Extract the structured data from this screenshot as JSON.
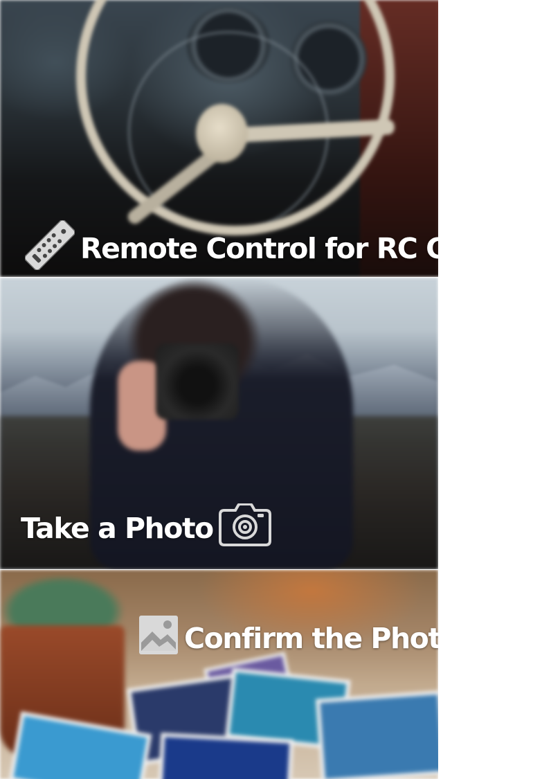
{
  "menu": {
    "items": [
      {
        "label": "Remote Control for RC Car",
        "icon": "remote-control-icon"
      },
      {
        "label": "Take a Photo",
        "icon": "camera-icon"
      },
      {
        "label": "Confirm the Photo",
        "icon": "image-icon"
      }
    ]
  },
  "colors": {
    "label_text": "#ffffff",
    "icon_fill": "#d9d9d9",
    "page_background": "#ffffff"
  }
}
